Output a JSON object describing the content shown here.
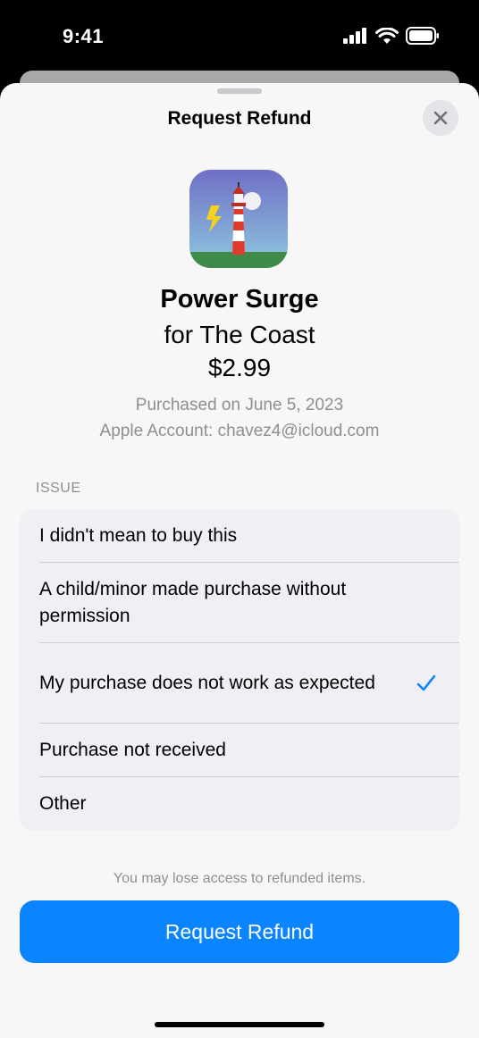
{
  "status_bar": {
    "time": "9:41"
  },
  "sheet": {
    "title": "Request Refund",
    "close_icon": "xmark-icon"
  },
  "product": {
    "icon": "lighthouse-app-icon",
    "name": "Power Surge",
    "subtitle": "for The Coast",
    "price": "$2.99",
    "purchased_on": "Purchased on June 5, 2023",
    "account": "Apple Account: chavez4@icloud.com"
  },
  "issue": {
    "header": "ISSUE",
    "options": [
      {
        "label": "I didn't mean to buy this",
        "selected": false
      },
      {
        "label": "A child/minor made purchase without permission",
        "selected": false
      },
      {
        "label": "My purchase does not work as expected",
        "selected": true
      },
      {
        "label": "Purchase not received",
        "selected": false
      },
      {
        "label": "Other",
        "selected": false
      }
    ]
  },
  "footer": {
    "note": "You may lose access to refunded items.",
    "button_label": "Request Refund"
  },
  "colors": {
    "accent": "#0a84ff",
    "sheet_bg": "#f7f7f7",
    "secondary_text": "#8e8e93"
  }
}
